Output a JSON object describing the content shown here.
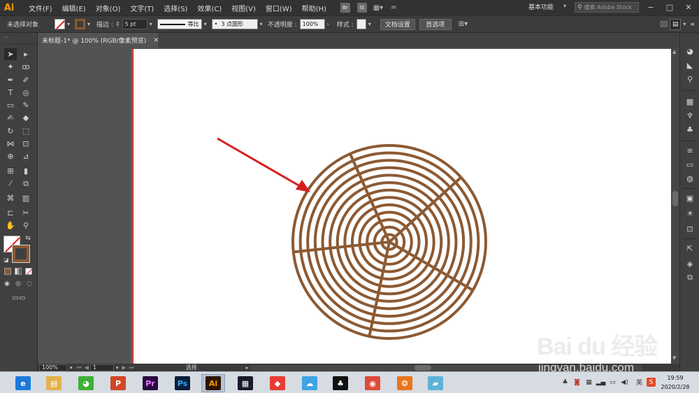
{
  "app": {
    "logo_text": "Ai"
  },
  "menu": {
    "items": [
      "文件(F)",
      "编辑(E)",
      "对象(O)",
      "文字(T)",
      "选择(S)",
      "效果(C)",
      "视图(V)",
      "窗口(W)",
      "帮助(H)"
    ],
    "badges": [
      "Br",
      "St"
    ],
    "workspace": "基本功能",
    "stock_search_placeholder": "搜索 Adobe Stock",
    "window_controls": [
      "−",
      "□",
      "✕"
    ]
  },
  "control_bar": {
    "selection_status": "未选择对象",
    "stroke_label": "描边 :",
    "stroke_weight": "5 pt",
    "stroke_profile": "等比",
    "brush_preset": "3 点圆形",
    "opacity_label": "不透明度 :",
    "opacity_value": "100%",
    "style_label": "样式 :",
    "doc_setup_button": "文档设置",
    "preferences_button": "首选项"
  },
  "document": {
    "tab_title": "未标题-1* @ 100% (RGB/像素预览)",
    "close_glyph": "×"
  },
  "status_bar": {
    "zoom": "100%",
    "artboard_number": "1",
    "tool_name": "选择"
  },
  "taskbar": {
    "apps": [
      {
        "name": "ie",
        "glyph": "e",
        "color": "#1b7ad9"
      },
      {
        "name": "explorer",
        "glyph": "▤",
        "color": "#e2b24a"
      },
      {
        "name": "wechat",
        "glyph": "◕",
        "color": "#3cb034"
      },
      {
        "name": "powerpoint",
        "glyph": "P",
        "color": "#d24625"
      },
      {
        "name": "premiere",
        "glyph": "Pr",
        "color": "#2a0a3f"
      },
      {
        "name": "photoshop",
        "glyph": "Ps",
        "color": "#0a1f3b"
      },
      {
        "name": "illustrator",
        "glyph": "Ai",
        "color": "#2c1500"
      },
      {
        "name": "video-editor",
        "glyph": "▦",
        "color": "#1a1a2a"
      },
      {
        "name": "media-app",
        "glyph": "◆",
        "color": "#e73d33"
      },
      {
        "name": "weather",
        "glyph": "☁",
        "color": "#3fa3e5"
      },
      {
        "name": "qq",
        "glyph": "♣",
        "color": "#111111"
      },
      {
        "name": "chrome",
        "glyph": "◉",
        "color": "#dd4b39"
      },
      {
        "name": "browser",
        "glyph": "❂",
        "color": "#e8761d"
      },
      {
        "name": "notes",
        "glyph": "▰",
        "color": "#5fb3d8"
      }
    ],
    "tray_ime": "英",
    "clock_time": "19:59",
    "clock_date": "2020/2/28"
  },
  "watermark": {
    "brand": "Bai du 经验",
    "url": "jingyan.baidu.com"
  },
  "colors": {
    "stroke_brown": "#8c5a33",
    "arrow_red": "#d61f1f",
    "menubar_bg": "#323232",
    "accent_orange": "#ff9a00"
  },
  "drawing": {
    "ring_count": 13,
    "spoke_count": 5,
    "stroke_color": "#8c5a33"
  }
}
